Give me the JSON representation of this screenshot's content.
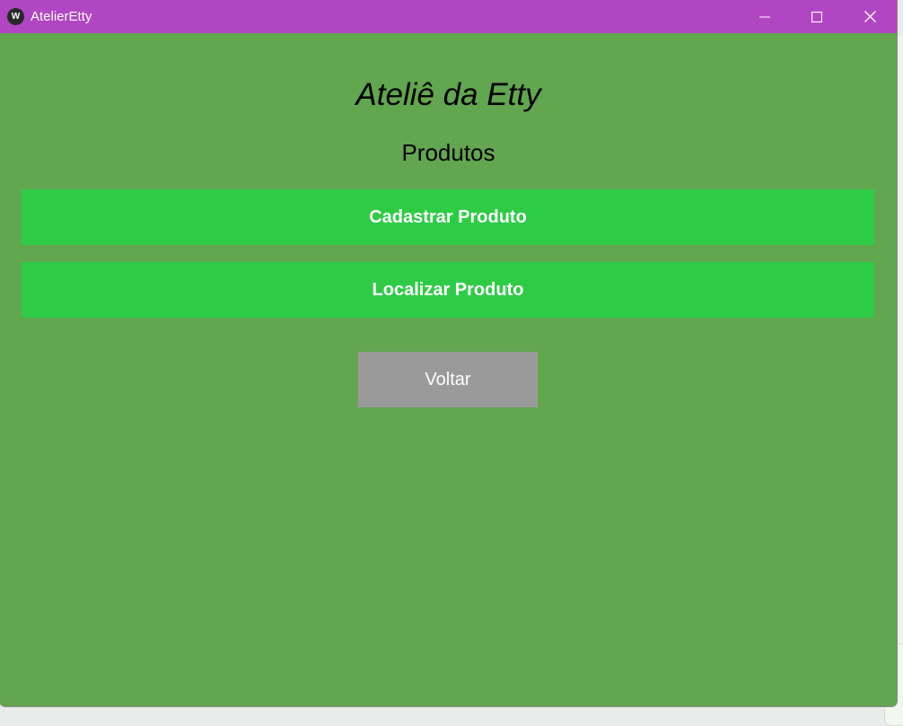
{
  "window": {
    "title": "AtelierEtty",
    "icon": "kivy-app-icon",
    "controls": [
      "minimize-icon",
      "maximize-icon",
      "close-icon"
    ]
  },
  "main": {
    "app_title": "Ateliê da Etty",
    "section_title": "Produtos",
    "buttons": {
      "cadastrar": "Cadastrar Produto",
      "localizar": "Localizar Produto",
      "voltar": "Voltar"
    }
  },
  "colors": {
    "titlebar": "#b146c3",
    "background": "#62a64f",
    "primary_button": "#2ecc46",
    "back_button": "#9a9a9a"
  }
}
